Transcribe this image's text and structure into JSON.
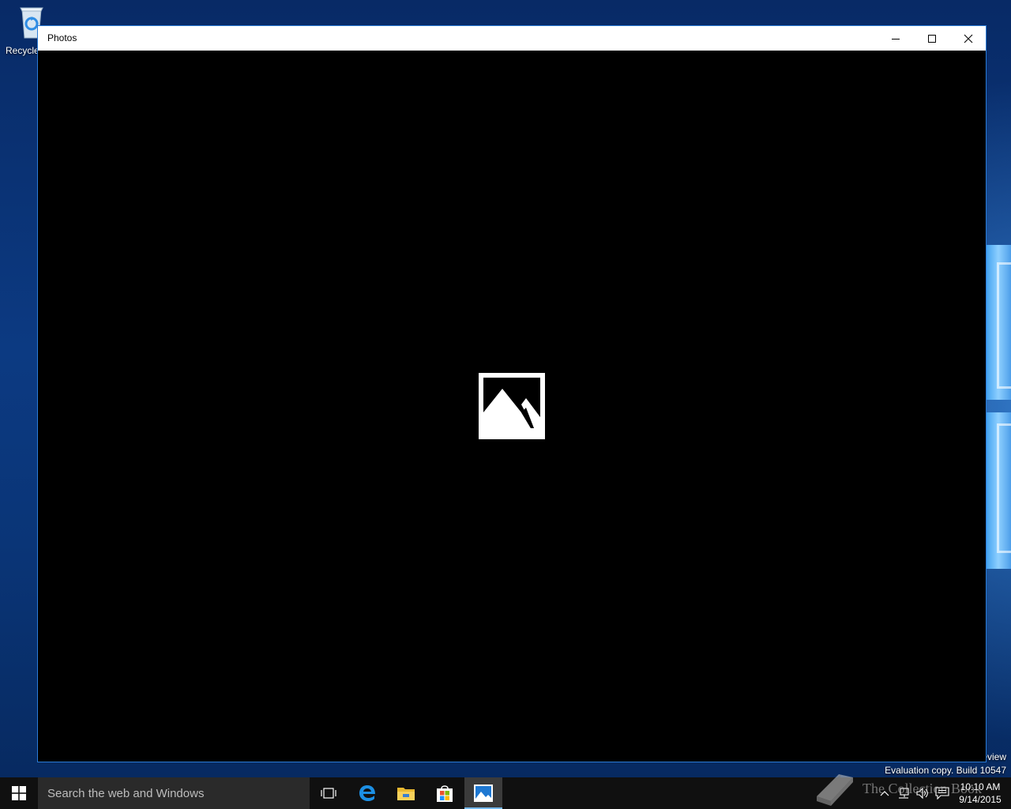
{
  "desktop": {
    "recycle_bin_label": "Recycle Bin",
    "watermark_line1": "eview",
    "watermark_line2": "Evaluation copy. Build 10547"
  },
  "window": {
    "title": "Photos",
    "content_icon": "image-placeholder-icon",
    "background_color": "#000000",
    "border_color": "#2b7bd6"
  },
  "taskbar": {
    "search_placeholder": "Search the web and Windows",
    "pinned": [
      "task-view-icon",
      "edge-icon",
      "file-explorer-icon",
      "store-icon",
      "photos-icon"
    ],
    "active_app": "photos-icon",
    "clock_time": "10:10 AM",
    "clock_date": "9/14/2015"
  },
  "branding": {
    "text": "The Collection Book"
  }
}
